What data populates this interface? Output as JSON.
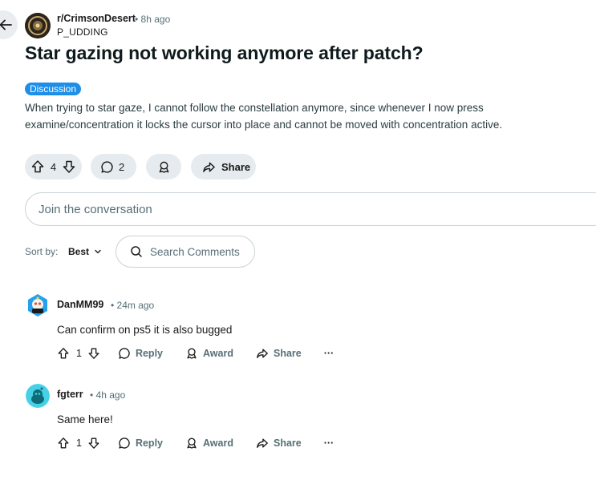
{
  "post": {
    "subreddit": "r/CrimsonDesert",
    "time": "• 8h ago",
    "author": "P_UDDING",
    "title": "Star gazing not working anymore after patch?",
    "flair": "Discussion",
    "body": "When trying to star gaze, I cannot follow the constellation anymore, since whenever I now press examine/concentration it locks the cursor into place and cannot be moved with concentration active.",
    "votes": "4",
    "comments": "2",
    "share_label": "Share"
  },
  "join_placeholder": "Join the conversation",
  "sort": {
    "label": "Sort by:",
    "value": "Best"
  },
  "search_comments": "Search Comments",
  "comments": [
    {
      "author": "DanMM99",
      "time": "• 24m ago",
      "text": "Can confirm on ps5 it is also bugged",
      "votes": "1",
      "reply": "Reply",
      "award": "Award",
      "share": "Share",
      "more": "···"
    },
    {
      "author": "fgterr",
      "time": "• 4h ago",
      "text": "Same here!",
      "votes": "1",
      "reply": "Reply",
      "award": "Award",
      "share": "Share",
      "more": "···"
    }
  ],
  "colors": {
    "flair_bg": "#1e8fe9",
    "pill_bg": "#e5ebee",
    "muted_text": "#576f76"
  }
}
